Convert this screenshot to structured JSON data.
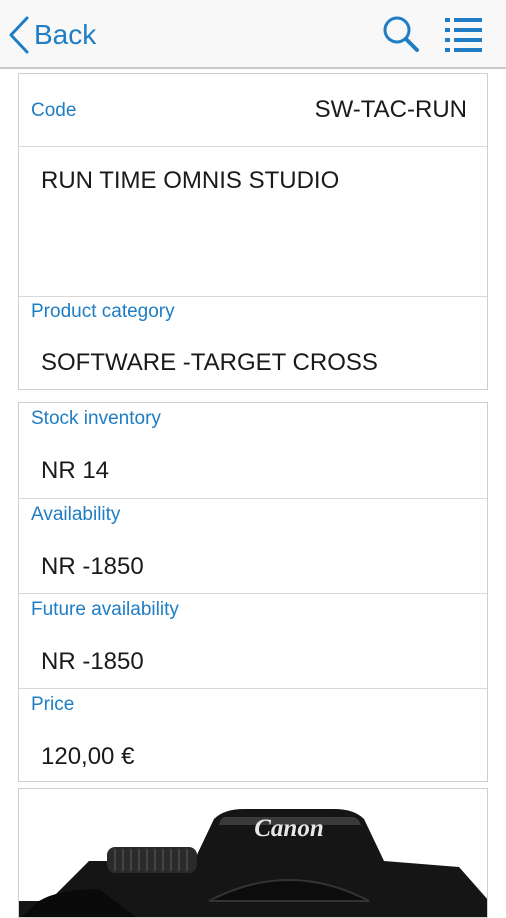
{
  "nav": {
    "back_label": "Back",
    "search_icon": "search-icon",
    "menu_icon": "list-menu-icon",
    "accent": "#1e7dc4"
  },
  "product": {
    "code_label": "Code",
    "code_value": "SW-TAC-RUN",
    "description": "RUN TIME OMNIS STUDIO",
    "category_label": "Product category",
    "category_value": "SOFTWARE -TARGET CROSS"
  },
  "stock": {
    "inventory_label": "Stock inventory",
    "inventory_value": "NR 14",
    "availability_label": "Availability",
    "availability_value": "NR -1850",
    "future_label": "Future availability",
    "future_value": "NR -1850",
    "price_label": "Price",
    "price_value": "120,00 €"
  },
  "image": {
    "brand_text": "Canon"
  }
}
